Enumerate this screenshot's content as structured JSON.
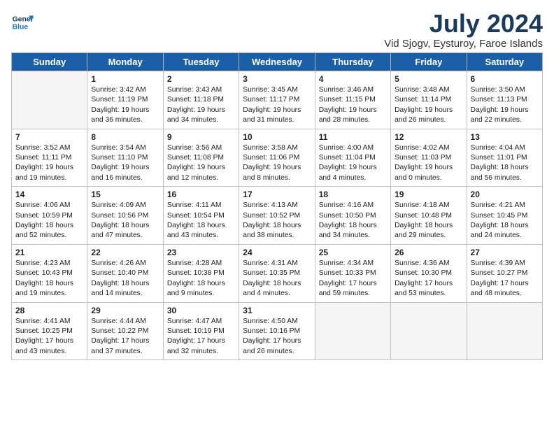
{
  "header": {
    "logo_line1": "General",
    "logo_line2": "Blue",
    "month_year": "July 2024",
    "location": "Vid Sjogv, Eysturoy, Faroe Islands"
  },
  "weekdays": [
    "Sunday",
    "Monday",
    "Tuesday",
    "Wednesday",
    "Thursday",
    "Friday",
    "Saturday"
  ],
  "weeks": [
    [
      {
        "day": "",
        "text": ""
      },
      {
        "day": "1",
        "text": "Sunrise: 3:42 AM\nSunset: 11:19 PM\nDaylight: 19 hours\nand 36 minutes."
      },
      {
        "day": "2",
        "text": "Sunrise: 3:43 AM\nSunset: 11:18 PM\nDaylight: 19 hours\nand 34 minutes."
      },
      {
        "day": "3",
        "text": "Sunrise: 3:45 AM\nSunset: 11:17 PM\nDaylight: 19 hours\nand 31 minutes."
      },
      {
        "day": "4",
        "text": "Sunrise: 3:46 AM\nSunset: 11:15 PM\nDaylight: 19 hours\nand 28 minutes."
      },
      {
        "day": "5",
        "text": "Sunrise: 3:48 AM\nSunset: 11:14 PM\nDaylight: 19 hours\nand 26 minutes."
      },
      {
        "day": "6",
        "text": "Sunrise: 3:50 AM\nSunset: 11:13 PM\nDaylight: 19 hours\nand 22 minutes."
      }
    ],
    [
      {
        "day": "7",
        "text": "Sunrise: 3:52 AM\nSunset: 11:11 PM\nDaylight: 19 hours\nand 19 minutes."
      },
      {
        "day": "8",
        "text": "Sunrise: 3:54 AM\nSunset: 11:10 PM\nDaylight: 19 hours\nand 16 minutes."
      },
      {
        "day": "9",
        "text": "Sunrise: 3:56 AM\nSunset: 11:08 PM\nDaylight: 19 hours\nand 12 minutes."
      },
      {
        "day": "10",
        "text": "Sunrise: 3:58 AM\nSunset: 11:06 PM\nDaylight: 19 hours\nand 8 minutes."
      },
      {
        "day": "11",
        "text": "Sunrise: 4:00 AM\nSunset: 11:04 PM\nDaylight: 19 hours\nand 4 minutes."
      },
      {
        "day": "12",
        "text": "Sunrise: 4:02 AM\nSunset: 11:03 PM\nDaylight: 19 hours\nand 0 minutes."
      },
      {
        "day": "13",
        "text": "Sunrise: 4:04 AM\nSunset: 11:01 PM\nDaylight: 18 hours\nand 56 minutes."
      }
    ],
    [
      {
        "day": "14",
        "text": "Sunrise: 4:06 AM\nSunset: 10:59 PM\nDaylight: 18 hours\nand 52 minutes."
      },
      {
        "day": "15",
        "text": "Sunrise: 4:09 AM\nSunset: 10:56 PM\nDaylight: 18 hours\nand 47 minutes."
      },
      {
        "day": "16",
        "text": "Sunrise: 4:11 AM\nSunset: 10:54 PM\nDaylight: 18 hours\nand 43 minutes."
      },
      {
        "day": "17",
        "text": "Sunrise: 4:13 AM\nSunset: 10:52 PM\nDaylight: 18 hours\nand 38 minutes."
      },
      {
        "day": "18",
        "text": "Sunrise: 4:16 AM\nSunset: 10:50 PM\nDaylight: 18 hours\nand 34 minutes."
      },
      {
        "day": "19",
        "text": "Sunrise: 4:18 AM\nSunset: 10:48 PM\nDaylight: 18 hours\nand 29 minutes."
      },
      {
        "day": "20",
        "text": "Sunrise: 4:21 AM\nSunset: 10:45 PM\nDaylight: 18 hours\nand 24 minutes."
      }
    ],
    [
      {
        "day": "21",
        "text": "Sunrise: 4:23 AM\nSunset: 10:43 PM\nDaylight: 18 hours\nand 19 minutes."
      },
      {
        "day": "22",
        "text": "Sunrise: 4:26 AM\nSunset: 10:40 PM\nDaylight: 18 hours\nand 14 minutes."
      },
      {
        "day": "23",
        "text": "Sunrise: 4:28 AM\nSunset: 10:38 PM\nDaylight: 18 hours\nand 9 minutes."
      },
      {
        "day": "24",
        "text": "Sunrise: 4:31 AM\nSunset: 10:35 PM\nDaylight: 18 hours\nand 4 minutes."
      },
      {
        "day": "25",
        "text": "Sunrise: 4:34 AM\nSunset: 10:33 PM\nDaylight: 17 hours\nand 59 minutes."
      },
      {
        "day": "26",
        "text": "Sunrise: 4:36 AM\nSunset: 10:30 PM\nDaylight: 17 hours\nand 53 minutes."
      },
      {
        "day": "27",
        "text": "Sunrise: 4:39 AM\nSunset: 10:27 PM\nDaylight: 17 hours\nand 48 minutes."
      }
    ],
    [
      {
        "day": "28",
        "text": "Sunrise: 4:41 AM\nSunset: 10:25 PM\nDaylight: 17 hours\nand 43 minutes."
      },
      {
        "day": "29",
        "text": "Sunrise: 4:44 AM\nSunset: 10:22 PM\nDaylight: 17 hours\nand 37 minutes."
      },
      {
        "day": "30",
        "text": "Sunrise: 4:47 AM\nSunset: 10:19 PM\nDaylight: 17 hours\nand 32 minutes."
      },
      {
        "day": "31",
        "text": "Sunrise: 4:50 AM\nSunset: 10:16 PM\nDaylight: 17 hours\nand 26 minutes."
      },
      {
        "day": "",
        "text": ""
      },
      {
        "day": "",
        "text": ""
      },
      {
        "day": "",
        "text": ""
      }
    ]
  ]
}
